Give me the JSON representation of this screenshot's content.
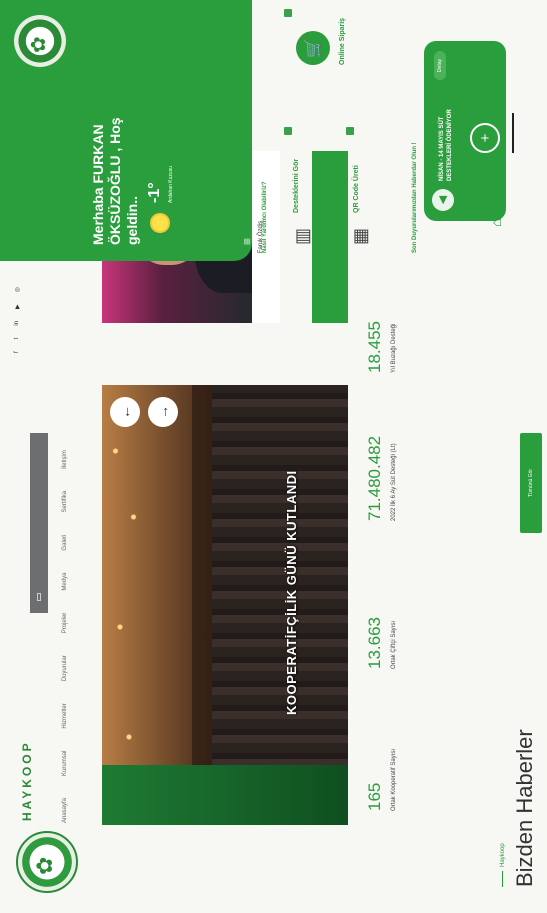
{
  "header": {
    "brand": "HAYKOOP",
    "brand_sub": "",
    "nav": [
      "Anasayfa",
      "Kurumsal",
      "Hizmetler",
      "Duyurular",
      "Projeler",
      "Medya",
      "Galeri",
      "Sertifika",
      "İletişim"
    ],
    "info_left": "",
    "info_pill": "",
    "info_right": "",
    "social": [
      "f",
      "t",
      "in",
      "▶",
      "◎"
    ]
  },
  "hero": {
    "title": "KOOPERATİFÇİLİK GÜNÜ KUTLANDI",
    "prev": "←",
    "next": "→"
  },
  "president": {
    "name": "Faruk Özdiş",
    "role": "",
    "links": [
      "",
      ""
    ]
  },
  "stats": [
    {
      "value": "165",
      "label": "Ortak Kooperatif Sayısı"
    },
    {
      "value": "13.663",
      "label": "Ortak Çiftçi Sayısı"
    },
    {
      "value": "71.480.482",
      "label": "2022 İlk 6 Ay Süt Desteği (Lt)"
    },
    {
      "value": "18.455",
      "label": "Yıl Buzağı Desteği"
    }
  ],
  "news": {
    "small": "Haykoop",
    "title": "Bizden Haberler",
    "all_button": "Tümünü Gör"
  },
  "panel": {
    "greeting": "Merhaba FURKAN ÖKSÜZOĞLU , Hoş geldin..",
    "temp": "-1°",
    "city": "Ardahan Kuzusu",
    "menu_icon": "≡",
    "help_title": "Nasıl Yardımcı Olabiliriz?",
    "services": [
      {
        "title": "Desteklerini Gör",
        "sub": ""
      },
      {
        "title": "Online Sipariş",
        "sub": ""
      },
      {
        "title": "QR Code Üreti",
        "sub": ""
      }
    ],
    "pay_title": "Son Duyurularımızdan Haberdar Olun !",
    "pay_date": "",
    "pay_text": "NİSAN - 14 MAYIS SÜT DESTEKLERİ ÖDENİYOR",
    "pay_detail": "Detay",
    "plus": "+",
    "home_icon": "⌂",
    "brand_c": "",
    "colors": {
      "accent": "#2a9d3d"
    }
  }
}
